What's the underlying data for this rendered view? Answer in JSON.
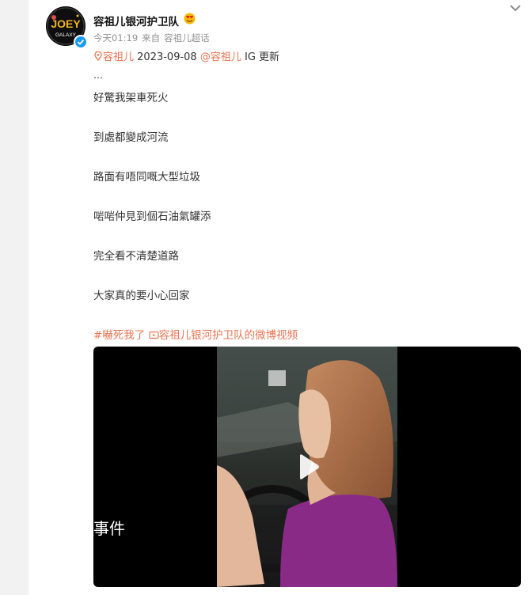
{
  "post": {
    "author_name": "容祖儿银河护卫队",
    "meta": {
      "time": "今天01:19",
      "source_prefix": "来自",
      "source": "容祖儿超话"
    },
    "repost_ref": {
      "topic_link": "容祖儿",
      "date": "2023-09-08",
      "mention": "@容祖儿",
      "suffix": "IG 更新"
    },
    "ellipsis": "…",
    "lines": [
      "好驚我架車死火",
      "到處都變成河流",
      "路面有唔同嘅大型垃圾",
      "啱啱仲見到個石油氣罐添",
      "完全看不清楚道路",
      "大家真的要小心回家"
    ],
    "hashtag": "#嚇死我了",
    "video_link": "容祖儿银河护卫队的微博视频",
    "video": {
      "caption": "事件"
    }
  },
  "colors": {
    "link": "#eb7350",
    "verified": "#1a9bf0"
  },
  "icons": {
    "avatar": "joey-galaxy-logo",
    "verified": "verified-badge-icon",
    "emoji": "heart-eyes-emoji-icon",
    "chevron": "chevron-down-icon",
    "location": "location-pin-icon",
    "video": "video-icon",
    "play": "play-icon"
  }
}
